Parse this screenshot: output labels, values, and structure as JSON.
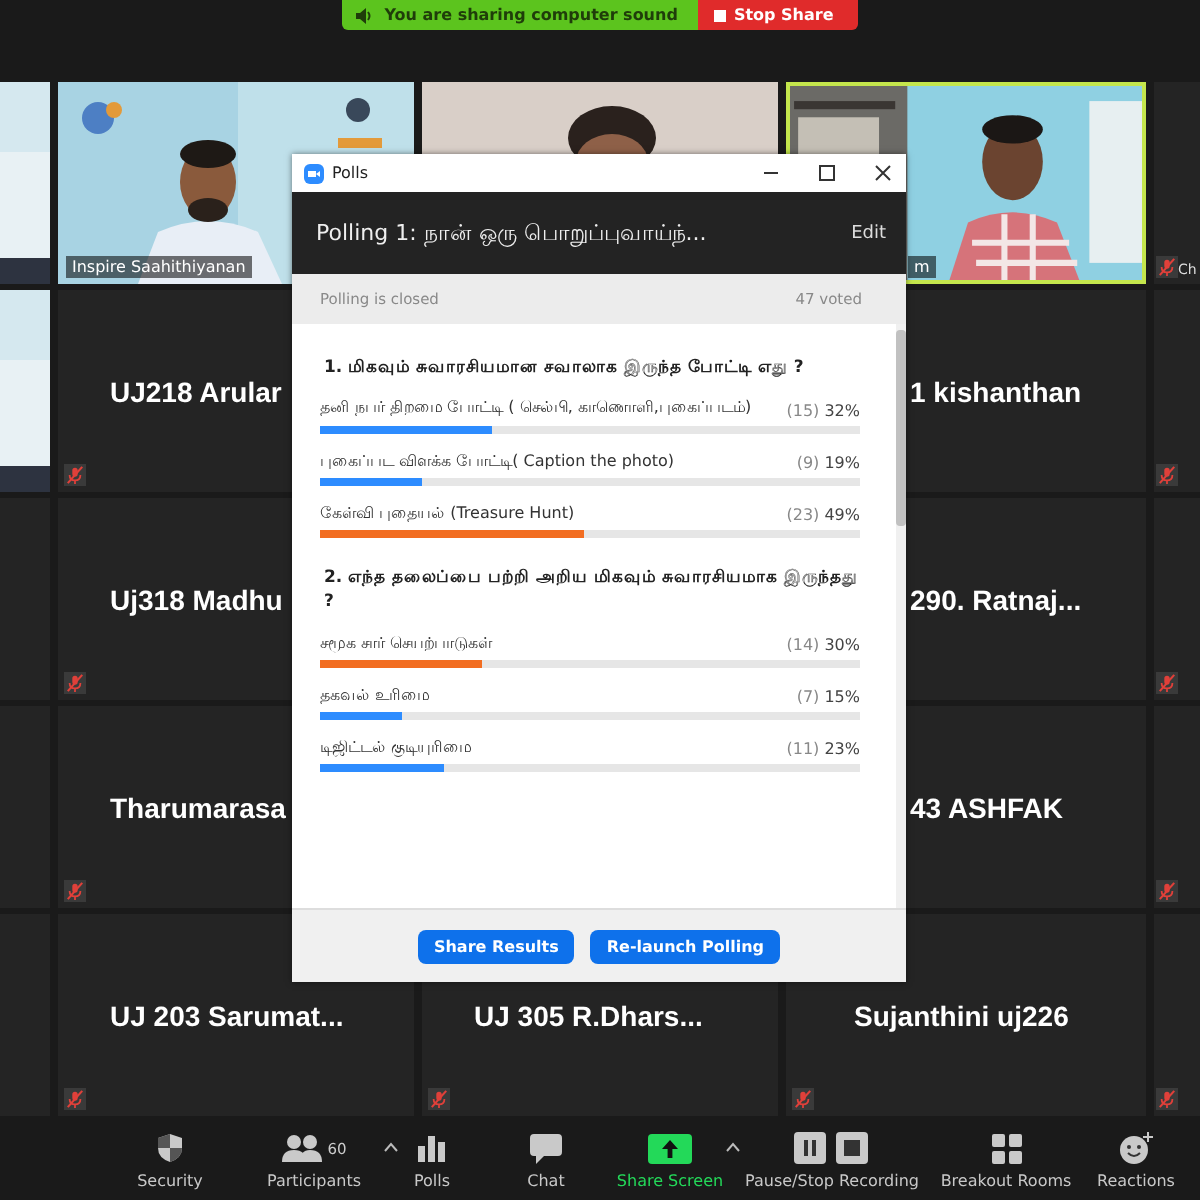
{
  "share_banner": {
    "message": "You are sharing computer sound",
    "stop_button": "Stop Share"
  },
  "tile_rows": [
    {
      "tiles": [
        {
          "kind": "video",
          "muted": false,
          "speaking": false
        },
        {
          "kind": "video",
          "name": "Inspire Saahithiyanan",
          "muted": false,
          "speaking": false
        },
        {
          "kind": "video",
          "muted": false,
          "speaking": false
        },
        {
          "kind": "video",
          "name": "m",
          "muted": false,
          "speaking": true
        },
        {
          "kind": "label",
          "name": "Ch",
          "muted": true,
          "speaking": false
        }
      ]
    },
    {
      "tiles": [
        {
          "kind": "video",
          "muted": false,
          "speaking": false
        },
        {
          "kind": "name",
          "name": "UJ218  Arular",
          "muted": true,
          "speaking": false
        },
        {
          "kind": "name",
          "name": "1 kishanthan",
          "muted": false,
          "speaking": false
        },
        {
          "kind": "blank",
          "muted": true,
          "speaking": false
        }
      ]
    },
    {
      "tiles": [
        {
          "kind": "blank",
          "muted": false,
          "speaking": false
        },
        {
          "kind": "name",
          "name": "Uj318  Madhu",
          "muted": true,
          "speaking": false
        },
        {
          "kind": "name",
          "name": "290.  Ratnaj...",
          "muted": false,
          "speaking": false
        },
        {
          "kind": "blank",
          "muted": true,
          "speaking": false
        }
      ]
    },
    {
      "tiles": [
        {
          "kind": "blank",
          "muted": false,
          "speaking": false
        },
        {
          "kind": "name",
          "name": "Tharumarasa",
          "muted": true,
          "speaking": false
        },
        {
          "kind": "name",
          "name": "43 ASHFAK",
          "muted": false,
          "speaking": false
        },
        {
          "kind": "blank",
          "muted": true,
          "speaking": false
        }
      ]
    },
    {
      "tiles": [
        {
          "kind": "blank",
          "muted": false,
          "speaking": false
        },
        {
          "kind": "name",
          "name": "UJ 203  Sarumat...",
          "muted": true,
          "speaking": false
        },
        {
          "kind": "name",
          "name": "UJ 305   R.Dhars...",
          "muted": true,
          "speaking": false
        },
        {
          "kind": "name",
          "name": "Sujanthini uj226",
          "muted": true,
          "speaking": false
        },
        {
          "kind": "blank",
          "muted": true,
          "speaking": false
        }
      ]
    }
  ],
  "polls_window": {
    "title": "Polls",
    "poll_title": "Polling 1: நான் ஒரு பொறுப்புவாய்ந்...",
    "edit": "Edit",
    "status": "Polling is closed",
    "voted": "47 voted",
    "questions": [
      {
        "text": "1. மிகவும் சுவாரசியமான சவாலாக இருந்த போட்டி எது ?",
        "answers": [
          {
            "text": "தனி நபர் திறமை போட்டி ( செல்பி, காணொளி,புகைப்படம்)",
            "count": "(15)",
            "percent": "32%",
            "level": 0.32,
            "color": "#2d8cff"
          },
          {
            "text": "புகைப்பட விளக்க போட்டி( Caption the photo)",
            "count": "(9)",
            "percent": "19%",
            "level": 0.19,
            "color": "#2d8cff"
          },
          {
            "text": "கேள்வி புதையல்  (Treasure Hunt)",
            "count": "(23)",
            "percent": "49%",
            "level": 0.49,
            "color": "#f26d21"
          }
        ]
      },
      {
        "text": "2. எந்த தலைப்பை  பற்றி அறிய மிகவும் சுவாரசியமாக இருந்தது ?",
        "answers": [
          {
            "text": "சமூக சார் செயற்பாடுகள்",
            "count": "(14)",
            "percent": "30%",
            "level": 0.3,
            "color": "#f26d21"
          },
          {
            "text": "தகவல் உரிமை",
            "count": "(7)",
            "percent": "15%",
            "level": 0.15,
            "color": "#2d8cff"
          },
          {
            "text": "டிஜிட்டல் குடியுரிமை",
            "count": "(11)",
            "percent": "23%",
            "level": 0.23,
            "color": "#2d8cff"
          }
        ]
      }
    ],
    "buttons": [
      "Share Results",
      "Re-launch Polling"
    ]
  },
  "toolbar": [
    {
      "kind": "security",
      "label": "Security"
    },
    {
      "kind": "participants",
      "label": "Participants",
      "badge": "60",
      "caret": true
    },
    {
      "kind": "polls",
      "label": "Polls"
    },
    {
      "kind": "chat",
      "label": "Chat"
    },
    {
      "kind": "share",
      "label": "Share Screen",
      "caret": true
    },
    {
      "kind": "recording",
      "label": "Pause/Stop Recording"
    },
    {
      "kind": "breakout",
      "label": "Breakout Rooms"
    },
    {
      "kind": "reactions",
      "label": "Reactions"
    }
  ]
}
